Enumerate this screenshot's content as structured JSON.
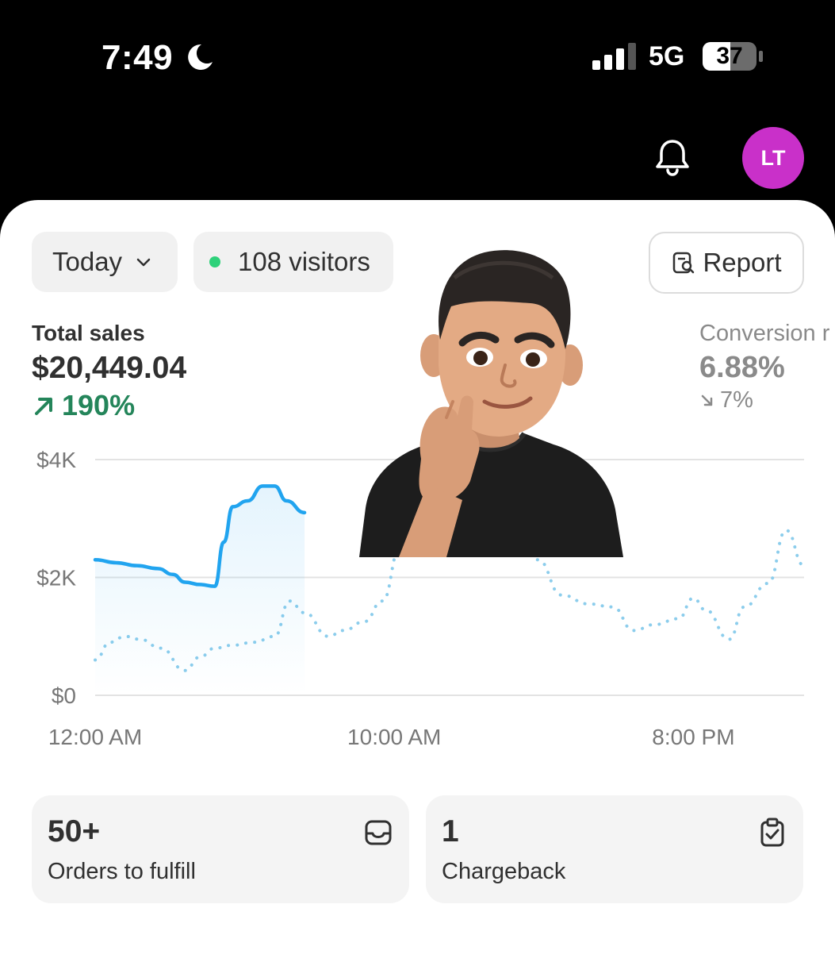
{
  "status_bar": {
    "time": "7:49",
    "network": "5G",
    "battery": "37"
  },
  "header": {
    "avatar_initials": "LT",
    "bell_icon": "bell-icon"
  },
  "filters": {
    "period_label": "Today",
    "visitors_label": "108 visitors",
    "visitors_dot_color": "#2ed17a",
    "report_label": "Report"
  },
  "metrics": {
    "total_sales": {
      "label": "Total sales",
      "value": "$20,449.04",
      "delta": "190%",
      "delta_color": "#24855a"
    },
    "conversion": {
      "label": "Conversion r",
      "value": "6.88%",
      "delta": "7%"
    }
  },
  "colors": {
    "accent_line": "#21a4ef",
    "compare_line": "#8ccdec",
    "avatar_bg": "#c930c9"
  },
  "chart_data": {
    "type": "line",
    "y_ticks": [
      "$4K",
      "$2K",
      "$0"
    ],
    "x_ticks": [
      "12:00 AM",
      "10:00 AM",
      "8:00 PM"
    ],
    "ylim": [
      0,
      4000
    ],
    "grid": true,
    "series": [
      {
        "style": "solid",
        "x": [
          0,
          0.7,
          1.4,
          2.1,
          2.6,
          3.0,
          3.5,
          4.0,
          4.3,
          4.6,
          5.1,
          5.6,
          6.0,
          6.4,
          7.0
        ],
        "values": [
          2300,
          2250,
          2200,
          2150,
          2050,
          1920,
          1880,
          1850,
          2600,
          3200,
          3300,
          3550,
          3550,
          3300,
          3100
        ]
      },
      {
        "style": "dotted",
        "x": [
          0,
          0.5,
          1.0,
          1.5,
          2.2,
          3.0,
          3.5,
          4.0,
          4.6,
          5.3,
          6.0,
          6.5,
          7.0,
          7.8,
          8.3,
          9.0,
          9.6,
          10.2,
          11.0,
          11.6,
          12.3,
          13.0,
          14.1,
          14.8,
          15.6,
          16.5,
          17.3,
          18.0,
          18.7,
          19.5,
          20.0,
          20.4,
          21.2,
          21.7,
          22.5,
          23.1,
          23.7
        ],
        "values": [
          600,
          900,
          1000,
          950,
          800,
          420,
          650,
          800,
          850,
          900,
          1000,
          1600,
          1400,
          1000,
          1100,
          1250,
          1600,
          2500,
          3200,
          3500,
          3300,
          2800,
          3000,
          2300,
          1700,
          1550,
          1500,
          1100,
          1200,
          1300,
          1650,
          1450,
          950,
          1500,
          1900,
          2800,
          2200
        ]
      }
    ]
  },
  "cards": [
    {
      "count": "50+",
      "label": "Orders to fulfill"
    },
    {
      "count": "1",
      "label": "Chargeback"
    }
  ]
}
